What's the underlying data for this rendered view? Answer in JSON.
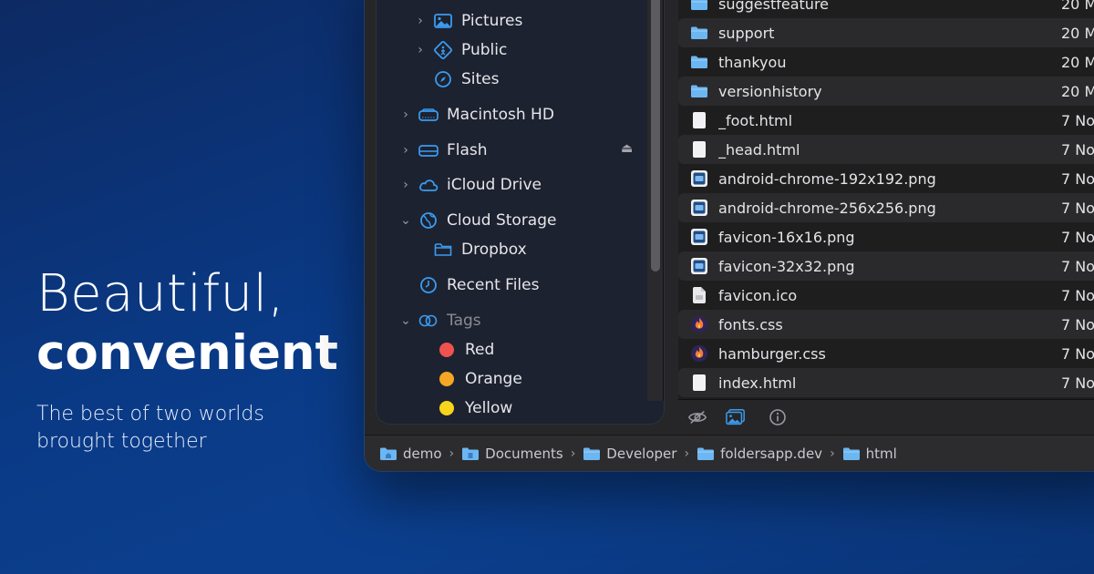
{
  "hero": {
    "line1": "Beautiful,",
    "line2": "convenient",
    "sub1": "The best of two worlds",
    "sub2": "brought together"
  },
  "sidebar": {
    "items": [
      {
        "label": "Pictures",
        "icon": "pictures-icon"
      },
      {
        "label": "Public",
        "icon": "public-icon"
      },
      {
        "label": "Sites",
        "icon": "compass-icon"
      },
      {
        "label": "Macintosh HD",
        "icon": "disk-icon"
      },
      {
        "label": "Flash",
        "icon": "drive-icon"
      },
      {
        "label": "iCloud Drive",
        "icon": "cloud-icon"
      },
      {
        "label": "Cloud Storage",
        "icon": "globe-icon"
      },
      {
        "label": "Dropbox",
        "icon": "folder-icon"
      },
      {
        "label": "Recent Files",
        "icon": "clock-icon"
      },
      {
        "label": "Tags",
        "icon": "tag-icon"
      }
    ],
    "tags": [
      {
        "label": "Red",
        "color": "#f0524f"
      },
      {
        "label": "Orange",
        "color": "#f5a623"
      },
      {
        "label": "Yellow",
        "color": "#f7d51d"
      }
    ]
  },
  "files": [
    {
      "name": "suggestfeature",
      "date": "20 M",
      "kind": "folder"
    },
    {
      "name": "support",
      "date": "20 M",
      "kind": "folder"
    },
    {
      "name": "thankyou",
      "date": "20 M",
      "kind": "folder"
    },
    {
      "name": "versionhistory",
      "date": "20 M",
      "kind": "folder"
    },
    {
      "name": "_foot.html",
      "date": "7 No",
      "kind": "html"
    },
    {
      "name": "_head.html",
      "date": "7 No",
      "kind": "html"
    },
    {
      "name": "android-chrome-192x192.png",
      "date": "7 No",
      "kind": "png"
    },
    {
      "name": "android-chrome-256x256.png",
      "date": "7 No",
      "kind": "png"
    },
    {
      "name": "favicon-16x16.png",
      "date": "7 No",
      "kind": "png"
    },
    {
      "name": "favicon-32x32.png",
      "date": "7 No",
      "kind": "png"
    },
    {
      "name": "favicon.ico",
      "date": "7 No",
      "kind": "ico"
    },
    {
      "name": "fonts.css",
      "date": "7 No",
      "kind": "css"
    },
    {
      "name": "hamburger.css",
      "date": "7 No",
      "kind": "css"
    },
    {
      "name": "index.html",
      "date": "7 No",
      "kind": "html"
    }
  ],
  "path": [
    "demo",
    "Documents",
    "Developer",
    "foldersapp.dev",
    "html"
  ],
  "colors": {
    "accent": "#3b9bf0",
    "folder": "#6cb7f2"
  }
}
